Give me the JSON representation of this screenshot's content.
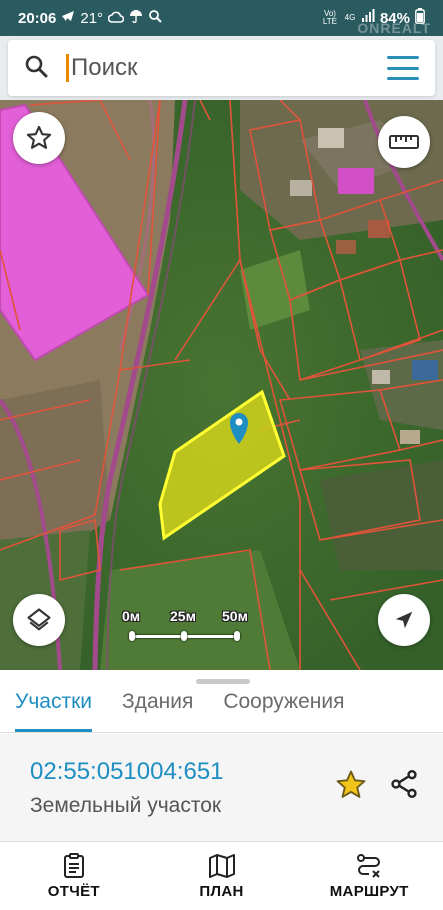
{
  "status": {
    "time": "20:06",
    "temperature": "21°",
    "network": "4G",
    "volte": "Vo) LTE",
    "battery": "84%",
    "icons": [
      "telegram-icon",
      "cloud-icon",
      "umbrella-icon",
      "search-icon",
      "signal-icon",
      "battery-icon"
    ]
  },
  "watermark": "ONREALT",
  "search": {
    "placeholder": "Поиск",
    "value": ""
  },
  "map": {
    "scale_labels": [
      "0м",
      "25м",
      "50м"
    ],
    "colors": {
      "selected_fill": "#d9d81a",
      "selected_stroke": "#ffff33",
      "parcel_border": "#e0543a",
      "building": "#e05ad8",
      "pin": "#1f8ec2"
    }
  },
  "tabs": [
    {
      "label": "Участки",
      "active": true
    },
    {
      "label": "Здания",
      "active": false
    },
    {
      "label": "Сооружения",
      "active": false
    }
  ],
  "parcel": {
    "cadastral_number": "02:55:051004:651",
    "type": "Земельный участок"
  },
  "nav": [
    {
      "label": "ОТЧЁТ",
      "icon": "report-icon"
    },
    {
      "label": "ПЛАН",
      "icon": "map-icon"
    },
    {
      "label": "МАРШРУТ",
      "icon": "route-icon"
    }
  ],
  "accent": "#1f8ec2"
}
